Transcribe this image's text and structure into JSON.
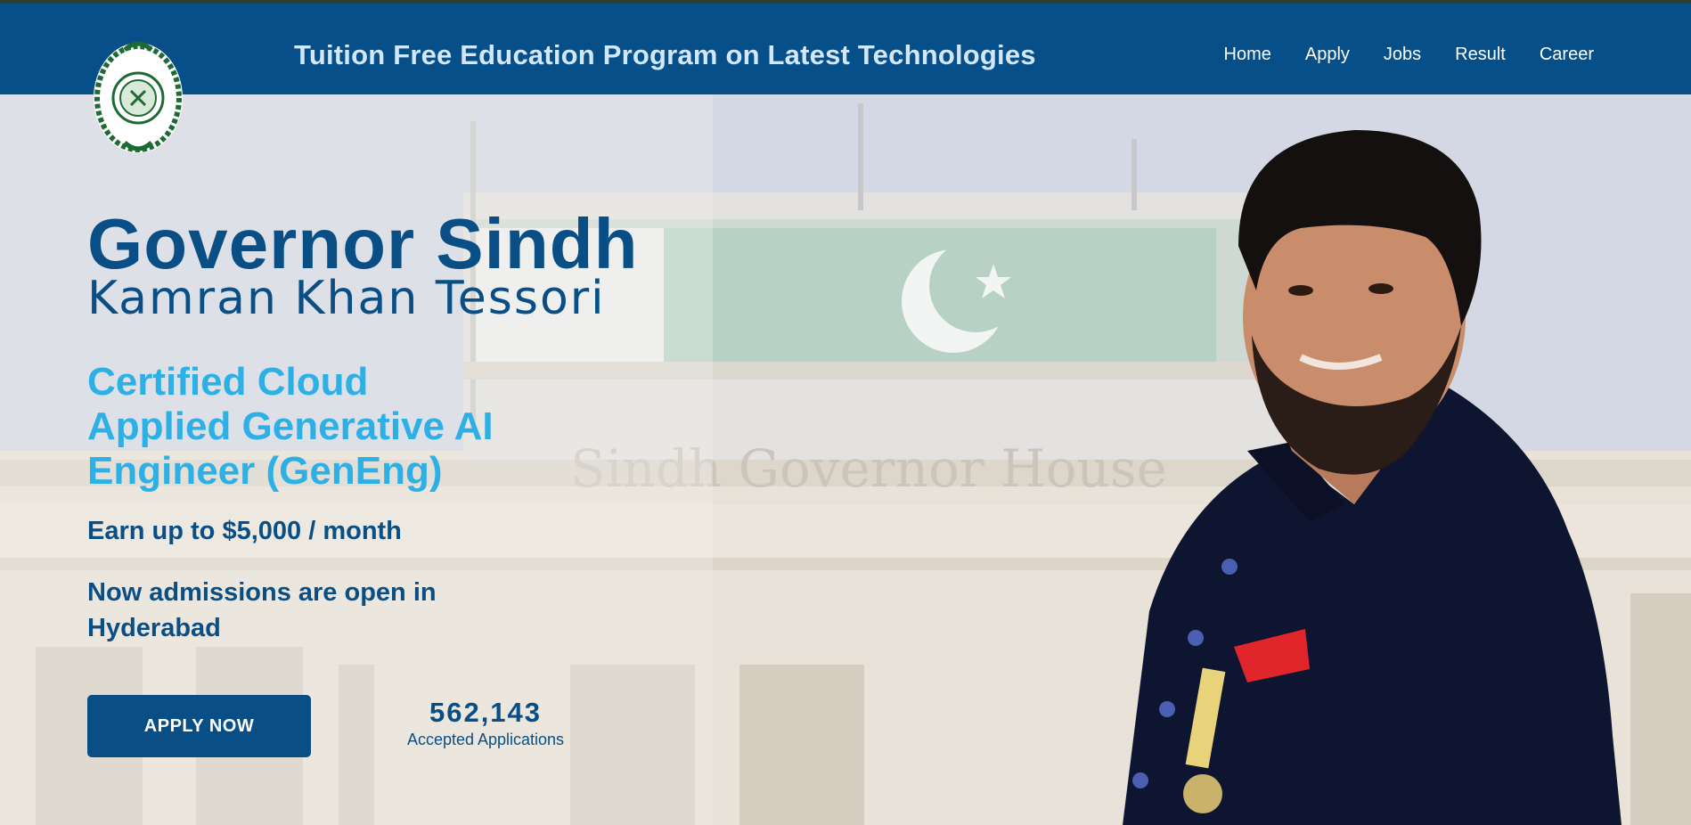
{
  "header": {
    "title": "Tuition Free Education Program on Latest Technologies",
    "logo_icon": "governor-seal-icon",
    "nav": [
      {
        "label": "Home"
      },
      {
        "label": "Apply"
      },
      {
        "label": "Jobs"
      },
      {
        "label": "Result"
      },
      {
        "label": "Career"
      }
    ]
  },
  "hero": {
    "title": "Governor Sindh",
    "name": "Kamran Khan Tessori",
    "program_lines": [
      "Certified Cloud",
      "Applied Generative AI",
      "Engineer (GenEng)"
    ],
    "earn": "Earn up to $5,000 / month",
    "admissions": "Now admissions are open in Hyderabad",
    "apply_label": "APPLY NOW",
    "counter_value": "562,143",
    "counter_label": "Accepted Applications",
    "background_sign": "Sindh Governor House"
  },
  "colors": {
    "nav_bg": "#064f88",
    "nav_title": "#d3e7fa",
    "primary": "#0a4e86",
    "accent": "#2db0e6"
  }
}
